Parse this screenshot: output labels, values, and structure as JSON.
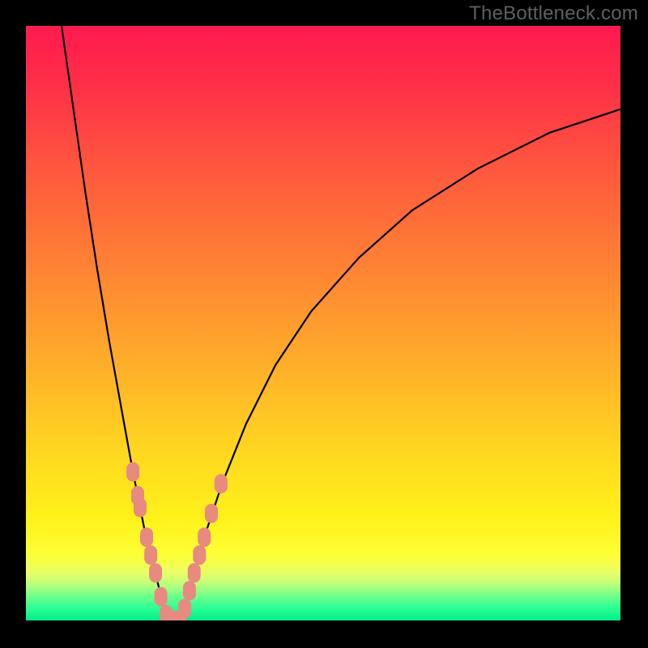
{
  "watermark": "TheBottleneck.com",
  "colors": {
    "frame": "#000000",
    "curve": "#000000",
    "marker": "#e88a80"
  },
  "chart_data": {
    "type": "line",
    "title": "",
    "xlabel": "",
    "ylabel": "",
    "xlim": [
      0,
      100
    ],
    "ylim": [
      0,
      100
    ],
    "grid": false,
    "series": [
      {
        "name": "left-curve",
        "x": [
          6,
          8,
          10,
          12,
          14,
          16,
          18,
          19,
          20,
          21,
          22,
          23,
          24
        ],
        "y": [
          100,
          86,
          72,
          59,
          47,
          36,
          25,
          20,
          15,
          11,
          7,
          3,
          0
        ]
      },
      {
        "name": "right-curve",
        "x": [
          26,
          27,
          28,
          30,
          33,
          37,
          42,
          48,
          56,
          65,
          76,
          88,
          100
        ],
        "y": [
          0,
          3,
          7,
          14,
          23,
          33,
          43,
          52,
          61,
          69,
          76,
          82,
          86
        ]
      }
    ],
    "markers": [
      {
        "series": "left-curve",
        "x": 18.0,
        "y": 25
      },
      {
        "series": "left-curve",
        "x": 18.8,
        "y": 21
      },
      {
        "series": "left-curve",
        "x": 19.2,
        "y": 19
      },
      {
        "series": "left-curve",
        "x": 20.3,
        "y": 14
      },
      {
        "series": "left-curve",
        "x": 21.0,
        "y": 11
      },
      {
        "series": "left-curve",
        "x": 21.8,
        "y": 8
      },
      {
        "series": "left-curve",
        "x": 22.7,
        "y": 4
      },
      {
        "series": "left-curve",
        "x": 23.6,
        "y": 1
      },
      {
        "series": "bottom",
        "x": 24.4,
        "y": 0
      },
      {
        "series": "bottom",
        "x": 25.2,
        "y": 0
      },
      {
        "series": "bottom",
        "x": 26.0,
        "y": 0
      },
      {
        "series": "right-curve",
        "x": 26.7,
        "y": 2
      },
      {
        "series": "right-curve",
        "x": 27.5,
        "y": 5
      },
      {
        "series": "right-curve",
        "x": 28.3,
        "y": 8
      },
      {
        "series": "right-curve",
        "x": 29.2,
        "y": 11
      },
      {
        "series": "right-curve",
        "x": 30.0,
        "y": 14
      },
      {
        "series": "right-curve",
        "x": 31.2,
        "y": 18
      },
      {
        "series": "right-curve",
        "x": 32.8,
        "y": 23
      }
    ],
    "background_gradient": {
      "orientation": "vertical",
      "stops": [
        {
          "pos": 0.0,
          "color": "#ff1a4f"
        },
        {
          "pos": 0.25,
          "color": "#ff5a3d"
        },
        {
          "pos": 0.58,
          "color": "#ffb129"
        },
        {
          "pos": 0.83,
          "color": "#fff21a"
        },
        {
          "pos": 1.0,
          "color": "#00ed87"
        }
      ]
    }
  }
}
